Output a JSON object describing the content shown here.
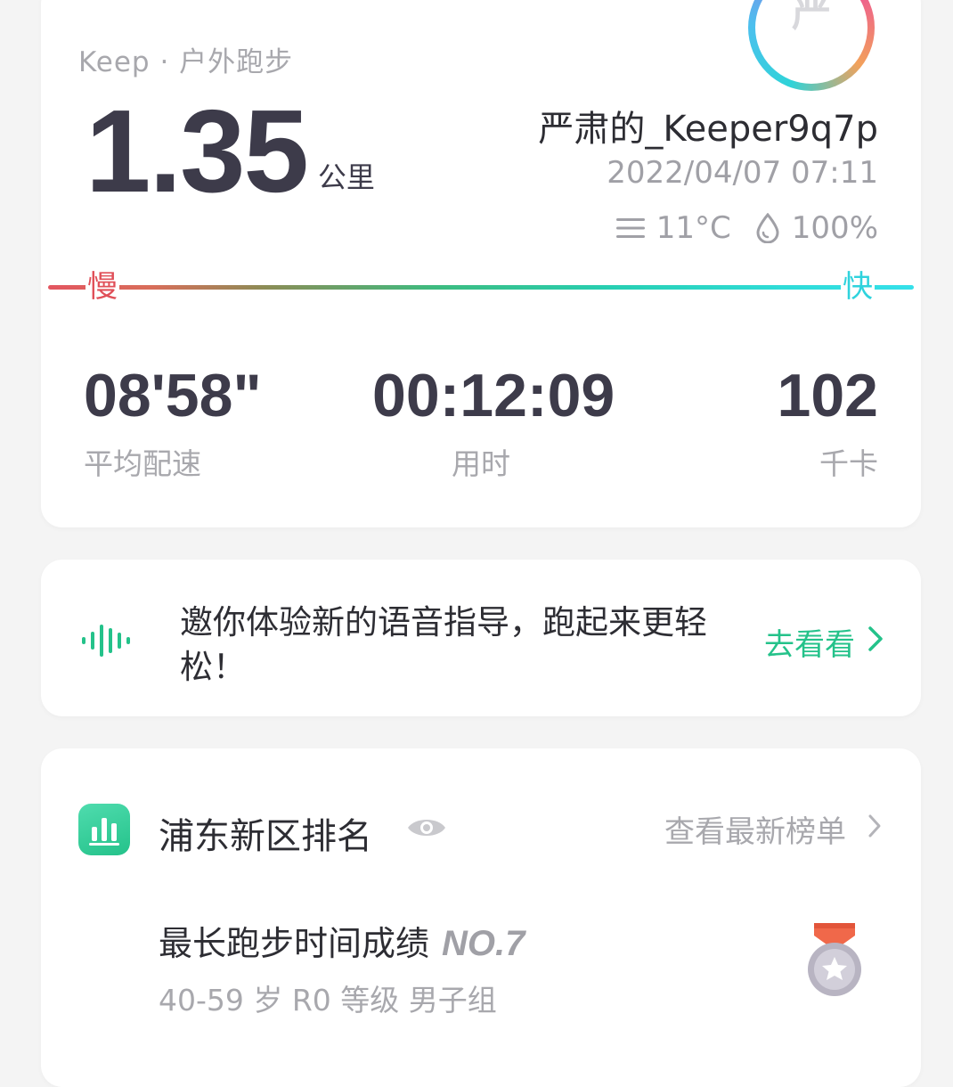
{
  "summary": {
    "source": "Keep · 户外跑步",
    "distance": "1.35",
    "distance_unit": "公里",
    "avatar_char": "严",
    "username": "严肃的_Keeper9q7p",
    "datetime": "2022/04/07 07:11",
    "temperature": "11°C",
    "humidity": "100%",
    "speed_slow_label": "慢",
    "speed_fast_label": "快",
    "stats": {
      "pace_value": "08'58\"",
      "pace_label": "平均配速",
      "duration_value": "00:12:09",
      "duration_label": "用时",
      "calories_value": "102",
      "calories_label": "千卡"
    }
  },
  "voice": {
    "text": "邀你体验新的语音指导，跑起来更轻松！",
    "link_label": "去看看"
  },
  "ranking": {
    "title": "浦东新区排名",
    "link_label": "查看最新榜单",
    "record_title": "最长跑步时间成绩",
    "record_rank": "NO.7",
    "record_subtitle": "40-59 岁 R0 等级 男子组"
  },
  "colors": {
    "accent_green": "#24c28a",
    "slow_red": "#e04f58",
    "fast_cyan": "#2fd3dd",
    "text_dark": "#3d3b4a",
    "text_muted": "#a8a8ad"
  },
  "icons": {
    "fog": "fog-icon",
    "humidity": "water-drop-icon",
    "voice": "voice-wave-icon",
    "chart": "bar-chart-icon",
    "eye": "eye-icon",
    "chevron": "chevron-right-icon",
    "medal": "medal-icon"
  }
}
